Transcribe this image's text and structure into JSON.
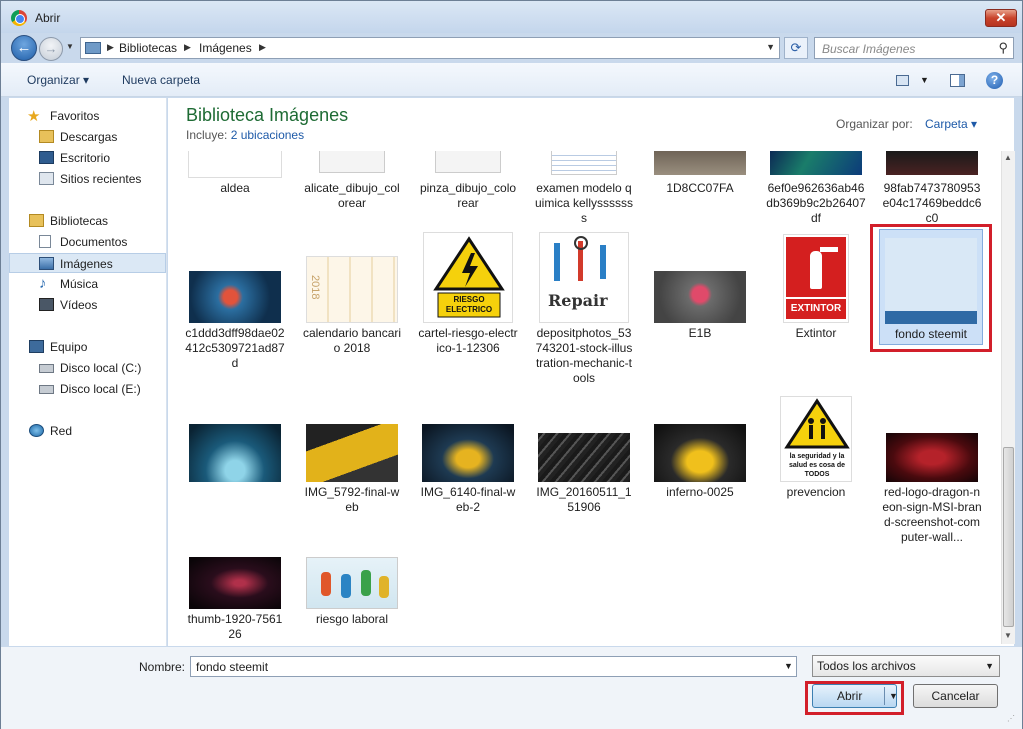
{
  "window": {
    "title": "Abrir",
    "close": "✕"
  },
  "nav": {
    "breadcrumbs": [
      "Bibliotecas",
      "Imágenes"
    ],
    "search_placeholder": "Buscar Imágenes"
  },
  "toolbar": {
    "organize": "Organizar ▾",
    "new_folder": "Nueva carpeta",
    "help": "?"
  },
  "sidebar": {
    "favorites": "Favoritos",
    "fav_items": [
      "Descargas",
      "Escritorio",
      "Sitios recientes"
    ],
    "libraries": "Bibliotecas",
    "lib_items": [
      "Documentos",
      "Imágenes",
      "Música",
      "Vídeos"
    ],
    "computer": "Equipo",
    "computer_items": [
      "Disco local (C:)",
      "Disco local (E:)"
    ],
    "network": "Red"
  },
  "library": {
    "title": "Biblioteca Imágenes",
    "includes_label": "Incluye:",
    "includes_link": "2 ubicaciones",
    "arrange_label": "Organizar por:",
    "arrange_value": "Carpeta ▾"
  },
  "files": {
    "row1": [
      "aldea",
      "alicate_dibujo_colorear",
      "pinza_dibujo_colorear",
      "examen modelo quimica kellysssssss",
      "1D8CC07FA",
      "6ef0e962636ab46db369b9c2b26407df",
      "98fab7473780953e04c17469beddc6c0"
    ],
    "row2": [
      "c1ddd3dff98dae02412c5309721ad87d",
      "calendario bancario 2018",
      "cartel-riesgo-electrico-1-12306",
      "depositphotos_53743201-stock-illustration-mechanic-tools",
      "E1B",
      "Extintor",
      "fondo steemit"
    ],
    "row3": [
      "",
      "IMG_5792-final-web",
      "IMG_6140-final-web-2",
      "IMG_20160511_151906",
      "inferno-0025",
      "prevencion",
      "red-logo-dragon-neon-sign-MSI-brand-screenshot-computer-wall..."
    ],
    "row4": [
      "thumb-1920-756126",
      "riesgo laboral"
    ]
  },
  "thumb_text": {
    "riesgo": "RIESGO ELECTRICO",
    "repair": "Repair",
    "extintor": "EXTINTOR",
    "prevencion": "la seguridad y la salud es cosa de TODOS",
    "calendar": "2018"
  },
  "footer": {
    "name_label": "Nombre:",
    "name_value": "fondo steemit",
    "filter_value": "Todos los archivos",
    "open": "Abrir",
    "cancel": "Cancelar"
  }
}
